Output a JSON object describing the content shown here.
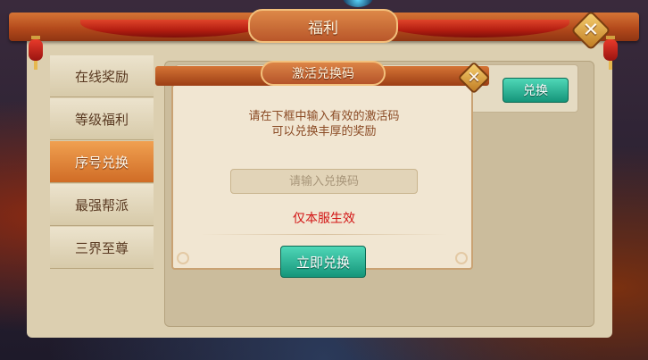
{
  "window": {
    "title": "福利"
  },
  "sidebar": {
    "items": [
      {
        "label": "在线奖励",
        "active": false
      },
      {
        "label": "等级福利",
        "active": false
      },
      {
        "label": "序号兑换",
        "active": true
      },
      {
        "label": "最强帮派",
        "active": false
      },
      {
        "label": "三界至尊",
        "active": false
      }
    ]
  },
  "content": {
    "exchange_button": "兑换"
  },
  "dialog": {
    "title": "激活兑换码",
    "instruction_line1": "请在下框中输入有效的激活码",
    "instruction_line2": "可以兑换丰厚的奖励",
    "input_placeholder": "请输入兑换码",
    "input_value": "",
    "server_note": "仅本服生效",
    "redeem_button": "立即兑换"
  },
  "icons": {
    "close": "close-icon",
    "lantern": "lantern-icon"
  },
  "colors": {
    "header": "#c05a24",
    "active_tab": "#e08a3a",
    "button": "#1fa888",
    "warning_text": "#d21414"
  }
}
